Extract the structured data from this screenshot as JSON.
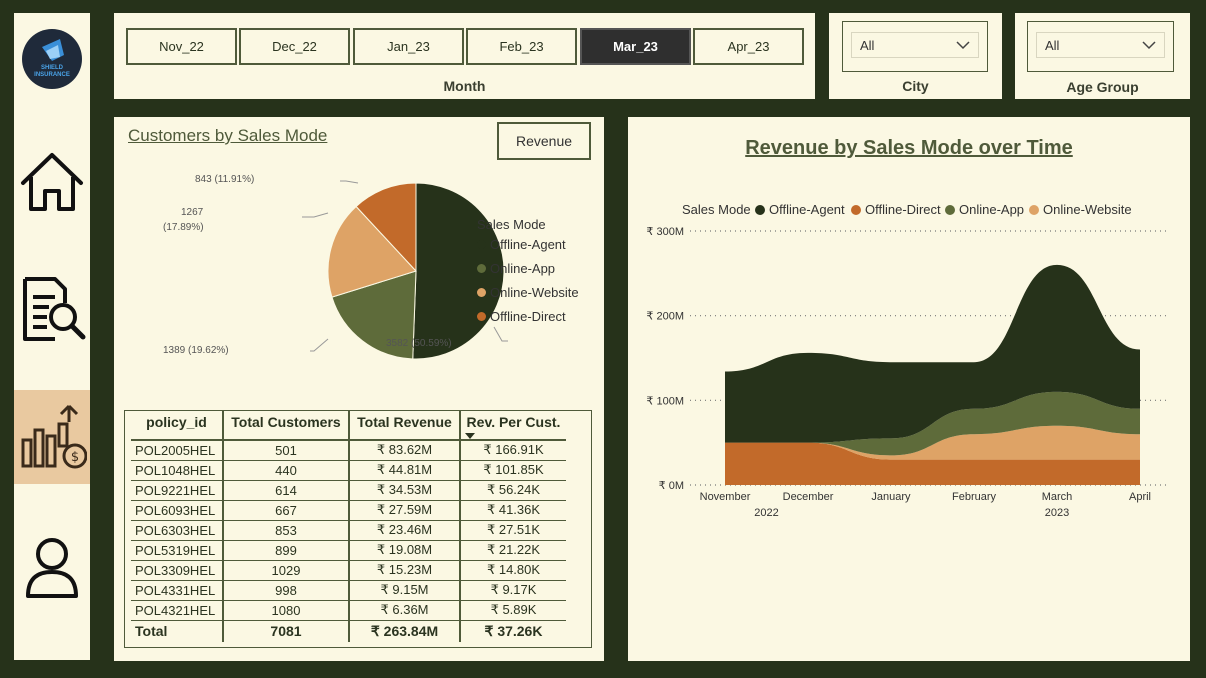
{
  "sidebar": {
    "logo_line1": "SHIELD",
    "logo_line2": "INSURANCE"
  },
  "month_slicer": {
    "months": [
      "Nov_22",
      "Dec_22",
      "Jan_23",
      "Feb_23",
      "Mar_23",
      "Apr_23"
    ],
    "selected": "Mar_23",
    "caption": "Month"
  },
  "filters": {
    "city": {
      "value": "All",
      "caption": "City"
    },
    "age_group": {
      "value": "All",
      "caption": "Age Group"
    }
  },
  "customers_panel": {
    "title": "Customers by Sales Mode",
    "revenue_button": "Revenue",
    "legend_title": "Sales Mode",
    "legend": [
      {
        "name": "Offline-Agent",
        "color": "#26321a"
      },
      {
        "name": "Online-App",
        "color": "#5e6b3a"
      },
      {
        "name": "Online-Website",
        "color": "#dea366"
      },
      {
        "name": "Offline-Direct",
        "color": "#c26a2a"
      }
    ],
    "pie_labels": {
      "offline_agent": "3582 (50.59%)",
      "online_app": "1389 (19.62%)",
      "online_website_1": "1267",
      "online_website_2": "(17.89%)",
      "offline_direct": "843 (11.91%)"
    }
  },
  "table": {
    "headers": [
      "policy_id",
      "Total Customers",
      "Total Revenue",
      "Rev. Per Cust."
    ],
    "rows": [
      [
        "POL2005HEL",
        "501",
        "₹ 83.62M",
        "₹ 166.91K"
      ],
      [
        "POL1048HEL",
        "440",
        "₹ 44.81M",
        "₹ 101.85K"
      ],
      [
        "POL9221HEL",
        "614",
        "₹ 34.53M",
        "₹ 56.24K"
      ],
      [
        "POL6093HEL",
        "667",
        "₹ 27.59M",
        "₹ 41.36K"
      ],
      [
        "POL6303HEL",
        "853",
        "₹ 23.46M",
        "₹ 27.51K"
      ],
      [
        "POL5319HEL",
        "899",
        "₹ 19.08M",
        "₹ 21.22K"
      ],
      [
        "POL3309HEL",
        "1029",
        "₹ 15.23M",
        "₹ 14.80K"
      ],
      [
        "POL4331HEL",
        "998",
        "₹ 9.15M",
        "₹ 9.17K"
      ],
      [
        "POL4321HEL",
        "1080",
        "₹ 6.36M",
        "₹ 5.89K"
      ]
    ],
    "total": [
      "Total",
      "7081",
      "₹ 263.84M",
      "₹ 37.26K"
    ]
  },
  "chart_data": [
    {
      "type": "pie",
      "title": "Customers by Sales Mode",
      "categories": [
        "Offline-Agent",
        "Online-App",
        "Online-Website",
        "Offline-Direct"
      ],
      "values": [
        3582,
        1389,
        1267,
        843
      ],
      "percentages": [
        50.59,
        19.62,
        17.89,
        11.91
      ],
      "colors": [
        "#26321a",
        "#5e6b3a",
        "#dea366",
        "#c26a2a"
      ],
      "legend_title": "Sales Mode",
      "legend_position": "right"
    },
    {
      "type": "area",
      "title": "Revenue by Sales Mode over Time",
      "legend_title": "Sales Mode",
      "legend_position": "top",
      "x": [
        "November",
        "December",
        "January",
        "February",
        "March",
        "April"
      ],
      "x_year_labels": [
        "2022",
        "2023"
      ],
      "y_ticks": [
        "₹ 0M",
        "₹ 100M",
        "₹ 200M",
        "₹ 300M"
      ],
      "ylim": [
        0,
        300
      ],
      "series": [
        {
          "name": "Offline-Direct",
          "color": "#c26a2a",
          "values": [
            50,
            50,
            30,
            30,
            30,
            30
          ]
        },
        {
          "name": "Online-Website",
          "color": "#dea366",
          "values": [
            0,
            0,
            5,
            30,
            40,
            30
          ]
        },
        {
          "name": "Online-App",
          "color": "#5e6b3a",
          "values": [
            0,
            0,
            20,
            30,
            40,
            30
          ]
        },
        {
          "name": "Offline-Agent",
          "color": "#26321a",
          "values": [
            84,
            106,
            90,
            55,
            150,
            70
          ]
        }
      ],
      "legend_order": [
        "Offline-Agent",
        "Offline-Direct",
        "Online-App",
        "Online-Website"
      ]
    }
  ]
}
